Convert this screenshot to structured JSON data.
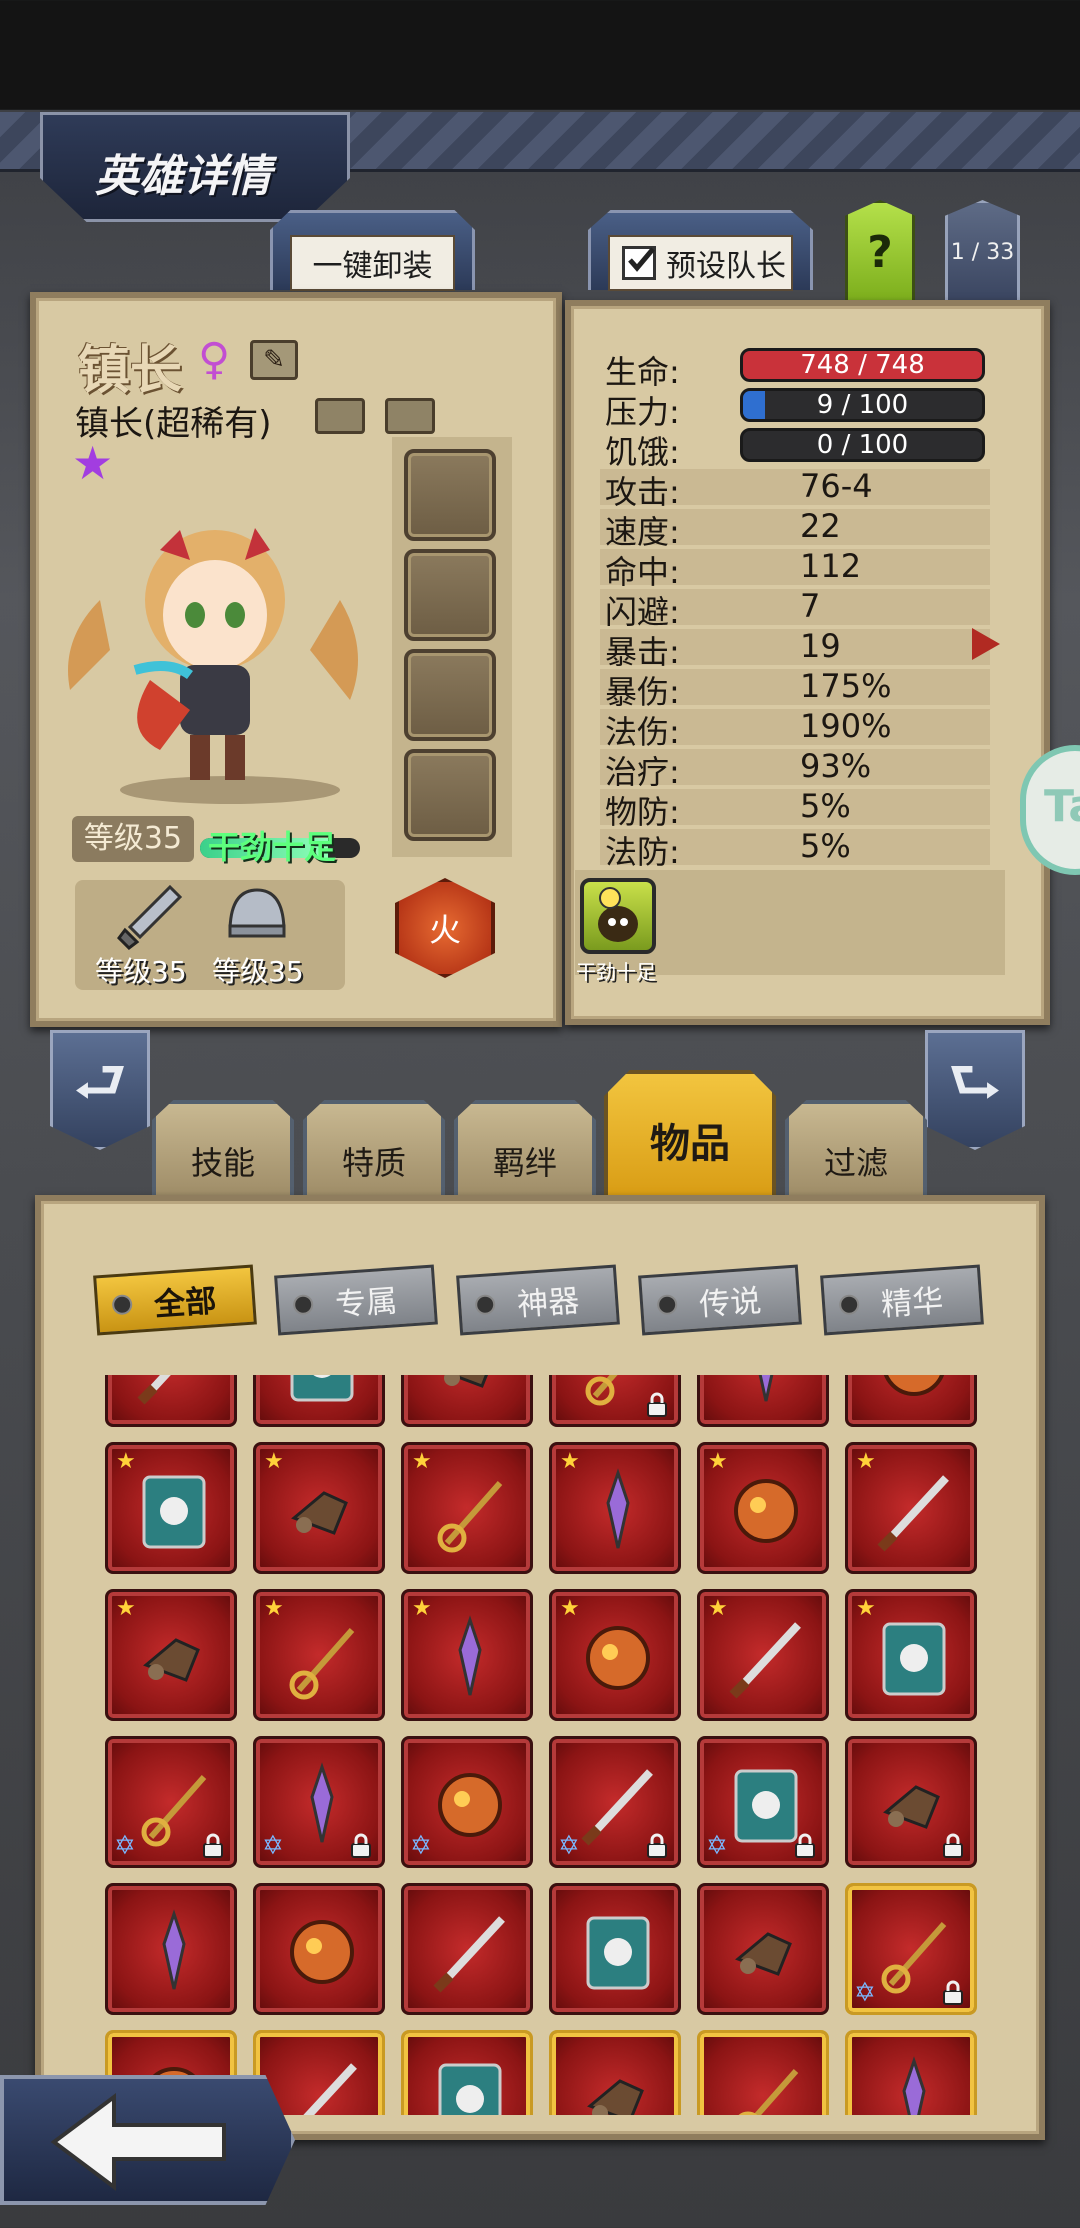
{
  "header": {
    "title": "英雄详情",
    "unequip_all": "一键卸装",
    "preset_leader": "预设队长",
    "help": "?",
    "page_counter": "1 / 33"
  },
  "hero": {
    "name": "镇长",
    "class_name": "镇长(超稀有)",
    "level": "等级35",
    "trait": "干劲十足",
    "weapon_level": "等级35",
    "armor_level": "等级35",
    "element": "火"
  },
  "stats": {
    "hp_label": "生命:",
    "hp_value": "748 / 748",
    "hp_fraction": 1.0,
    "stress_label": "压力:",
    "stress_value": "9 / 100",
    "stress_fraction": 0.09,
    "hunger_label": "饥饿:",
    "hunger_value": "0 / 100",
    "hunger_fraction": 0.0,
    "rows": [
      {
        "label": "攻击:",
        "value": "76-4"
      },
      {
        "label": "速度:",
        "value": "22"
      },
      {
        "label": "命中:",
        "value": "112"
      },
      {
        "label": "闪避:",
        "value": "7"
      },
      {
        "label": "暴击:",
        "value": "19"
      },
      {
        "label": "暴伤:",
        "value": "175%"
      },
      {
        "label": "法伤:",
        "value": "190%"
      },
      {
        "label": "治疗:",
        "value": "93%"
      },
      {
        "label": "物防:",
        "value": "5%"
      },
      {
        "label": "法防:",
        "value": "5%"
      }
    ],
    "buff_label": "干劲十足"
  },
  "tabs": [
    "技能",
    "特质",
    "羁绊",
    "物品",
    "过滤"
  ],
  "active_tab": "物品",
  "filters": [
    "全部",
    "专属",
    "神器",
    "传说",
    "精华"
  ],
  "active_filter": "全部",
  "side_badge": "Ta",
  "colors": {
    "hp": "#c9323a",
    "stress": "#2f6fd0",
    "accent_gold": "#e9b92a",
    "item_red": "#9b1b1b"
  }
}
